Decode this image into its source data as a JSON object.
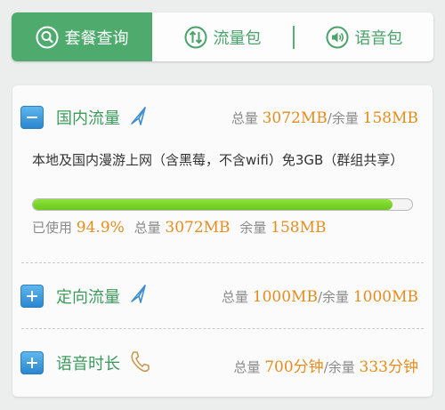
{
  "tabs": [
    {
      "label": "套餐查询",
      "icon": "search-icon",
      "active": true
    },
    {
      "label": "流量包",
      "icon": "updown-arrows-icon",
      "active": false
    },
    {
      "label": "语音包",
      "icon": "speaker-icon",
      "active": false
    }
  ],
  "domestic": {
    "title": "国内流量",
    "icon": "paper-plane-icon",
    "expanded": true,
    "total_label": "总量",
    "total": "3072MB",
    "sep": "/",
    "remain_label": "余量",
    "remain": "158MB",
    "desc": "本地及国内漫游上网（含黑莓，不含wifi）免3GB（群组共享）",
    "progress": 0.949,
    "used_label": "已使用",
    "used_pct": "94.9%",
    "total_label2": "总量",
    "total2": "3072MB",
    "remain_label2": "余量",
    "remain2": "158MB"
  },
  "directed": {
    "title": "定向流量",
    "icon": "paper-plane-icon",
    "expanded": false,
    "total_label": "总量",
    "total": "1000MB",
    "sep": "/",
    "remain_label": "余量",
    "remain": "1000MB"
  },
  "voice": {
    "title": "语音时长",
    "icon": "phone-icon",
    "expanded": false,
    "total_label": "总量",
    "total": "700分钟",
    "sep": "/",
    "remain_label": "余量",
    "remain": "333分钟"
  },
  "colors": {
    "accent": "#4eaa6d",
    "number": "#e58d1e",
    "progress": "#7ed62a"
  }
}
